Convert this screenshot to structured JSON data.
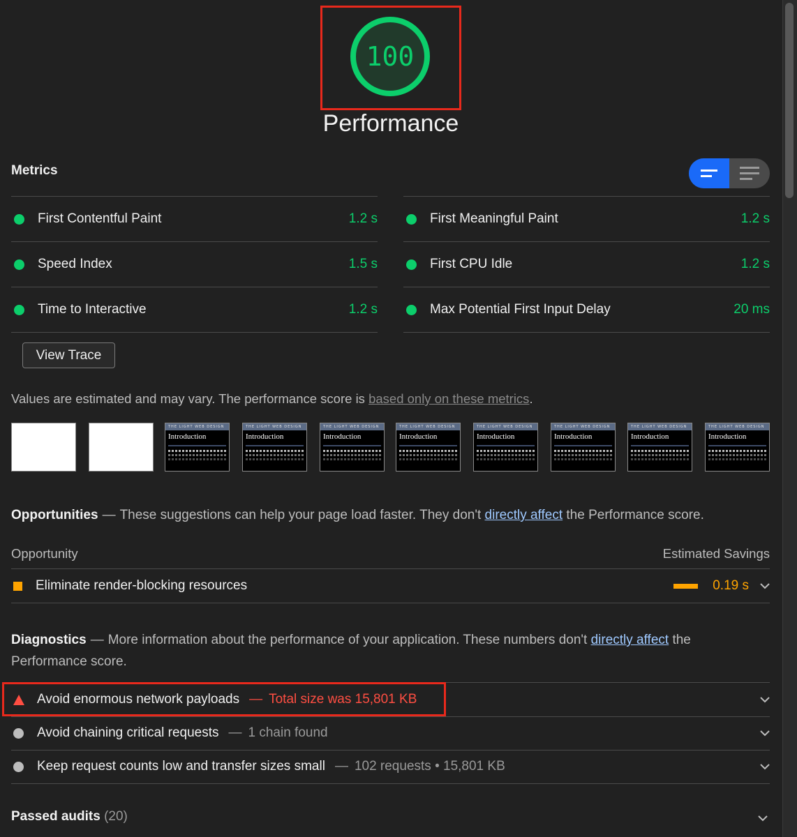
{
  "score": {
    "value": "100",
    "title": "Performance",
    "color": "#0cce6b"
  },
  "metrics": {
    "title": "Metrics",
    "left": [
      {
        "label": "First Contentful Paint",
        "value": "1.2 s"
      },
      {
        "label": "Speed Index",
        "value": "1.5 s"
      },
      {
        "label": "Time to Interactive",
        "value": "1.2 s"
      }
    ],
    "right": [
      {
        "label": "First Meaningful Paint",
        "value": "1.2 s"
      },
      {
        "label": "First CPU Idle",
        "value": "1.2 s"
      },
      {
        "label": "Max Potential First Input Delay",
        "value": "20 ms"
      }
    ],
    "view_trace_label": "View Trace",
    "estimate_text": "Values are estimated and may vary. The performance score is ",
    "estimate_link": "based only on these metrics",
    "estimate_end": "."
  },
  "filmstrip": {
    "header_text": "THE LIGHT WEB DESIGN",
    "frame_title": "Introduction"
  },
  "opportunities": {
    "title": "Opportunities",
    "desc_start": "These suggestions can help your page load faster. They don't ",
    "link": "directly affect",
    "desc_end": " the Performance score.",
    "col_opportunity": "Opportunity",
    "col_savings": "Estimated Savings",
    "items": [
      {
        "label": "Eliminate render-blocking resources",
        "value": "0.19 s"
      }
    ]
  },
  "diagnostics": {
    "title": "Diagnostics",
    "desc_start": "More information about the performance of your application. These numbers don't ",
    "link": "directly affect",
    "desc_end": " the",
    "desc_line2": "Performance score.",
    "items": [
      {
        "label": "Avoid enormous network payloads",
        "detail": "Total size was 15,801 KB"
      },
      {
        "label": "Avoid chaining critical requests",
        "detail": "1 chain found"
      },
      {
        "label": "Keep request counts low and transfer sizes small",
        "detail": "102 requests • 15,801 KB"
      }
    ]
  },
  "passed": {
    "label": "Passed audits",
    "count": "(20)"
  },
  "dash": "—"
}
